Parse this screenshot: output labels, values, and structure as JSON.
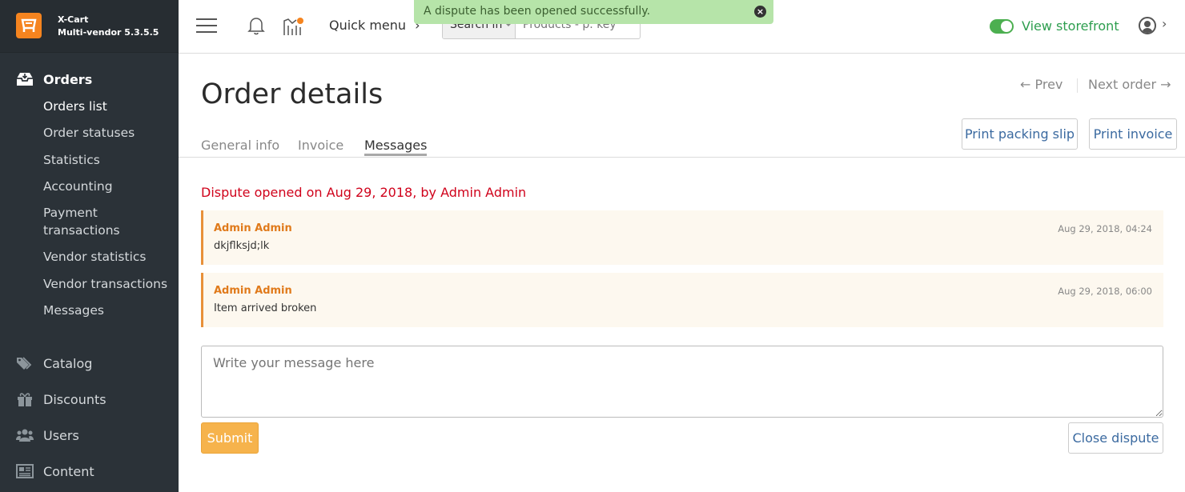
{
  "brand": {
    "name": "X-Cart",
    "version": "Multi-vendor 5.3.5.5",
    "logo_icon": "cart-logo-icon",
    "logo_color": "#f5841f"
  },
  "sidebar": {
    "orders": {
      "label": "Orders",
      "icon": "inbox-icon",
      "items": [
        {
          "label": "Orders list",
          "active": true
        },
        {
          "label": "Order statuses"
        },
        {
          "label": "Statistics"
        },
        {
          "label": "Accounting"
        },
        {
          "label": "Payment",
          "label2": "transactions"
        },
        {
          "label": "Vendor statistics"
        },
        {
          "label": "Vendor transactions"
        },
        {
          "label": "Messages"
        }
      ]
    },
    "groups": [
      {
        "label": "Catalog",
        "icon": "tags-icon"
      },
      {
        "label": "Discounts",
        "icon": "gift-icon"
      },
      {
        "label": "Users",
        "icon": "users-icon"
      },
      {
        "label": "Content",
        "icon": "content-icon"
      }
    ]
  },
  "topbar": {
    "quick_menu": "Quick menu",
    "search_in": "Search in",
    "search_placeholder": "Products - p. key",
    "view_storefront": "View storefront",
    "accent_green": "#2e9e4f"
  },
  "toast": {
    "message": "A dispute has been opened successfully.",
    "close": "×",
    "color": "#b6e4a9"
  },
  "page": {
    "title": "Order details",
    "prev": "← Prev",
    "next": "Next order →",
    "tabs": [
      {
        "label": "General info"
      },
      {
        "label": "Invoice"
      },
      {
        "label": "Messages",
        "active": true
      }
    ],
    "print_packing_slip": "Print packing slip",
    "print_invoice": "Print invoice"
  },
  "messages": {
    "dispute_notice": "Dispute opened on Aug 29, 2018, by Admin Admin",
    "items": [
      {
        "author": "Admin Admin",
        "date": "Aug 29, 2018, 04:24",
        "text": "dkjflksjd;lk"
      },
      {
        "author": "Admin Admin",
        "date": "Aug 29, 2018, 06:00",
        "text": "Item arrived broken"
      }
    ],
    "placeholder": "Write your message here",
    "submit": "Submit",
    "close_dispute": "Close dispute"
  }
}
